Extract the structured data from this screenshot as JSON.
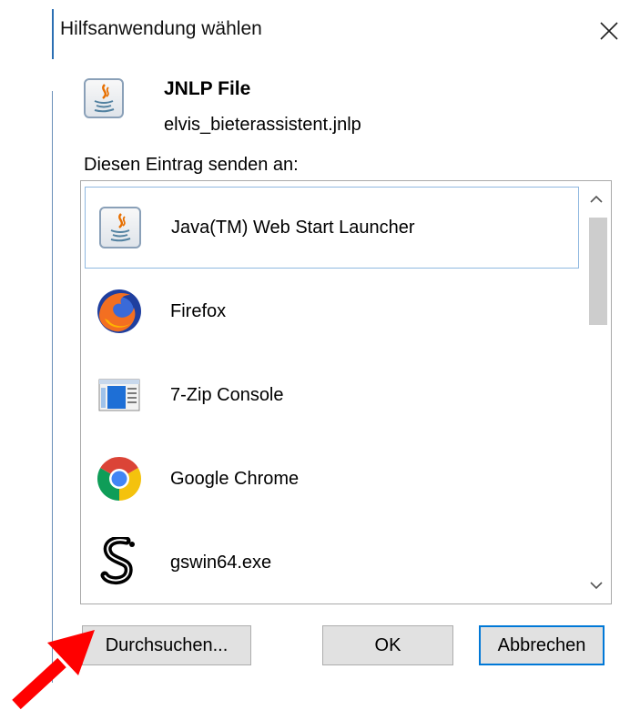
{
  "window": {
    "title": "Hilfsanwendung wählen"
  },
  "file": {
    "type": "JNLP File",
    "name": "elvis_bieterassistent.jnlp",
    "icon": "java-icon"
  },
  "send_to_label": "Diesen Eintrag senden an:",
  "applications": [
    {
      "label": "Java(TM) Web Start Launcher",
      "icon": "java-icon",
      "selected": true
    },
    {
      "label": "Firefox",
      "icon": "firefox-icon",
      "selected": false
    },
    {
      "label": "7-Zip Console",
      "icon": "console-icon",
      "selected": false
    },
    {
      "label": "Google Chrome",
      "icon": "chrome-icon",
      "selected": false
    },
    {
      "label": "gswin64.exe",
      "icon": "ghostscript-icon",
      "selected": false
    }
  ],
  "buttons": {
    "browse": "Durchsuchen...",
    "ok": "OK",
    "cancel": "Abbrechen"
  },
  "colors": {
    "accent": "#0078d7",
    "annotation_arrow": "#ff0000"
  }
}
